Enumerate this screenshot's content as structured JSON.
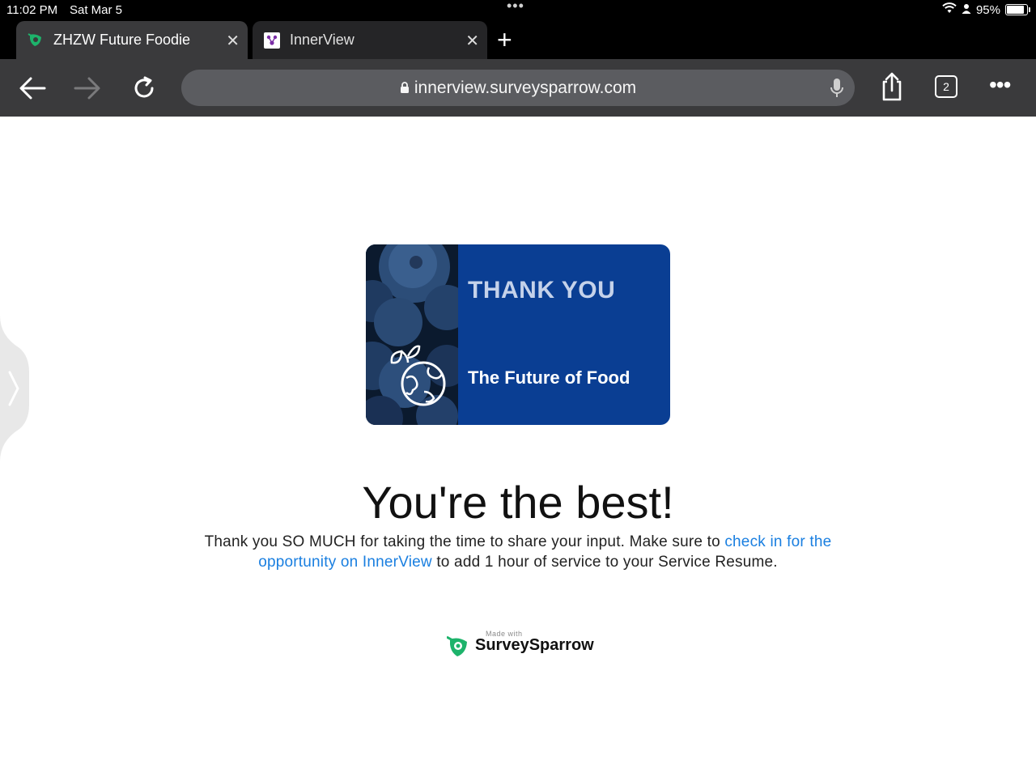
{
  "status_bar": {
    "time": "11:02 PM",
    "date": "Sat Mar 5",
    "battery": "95%"
  },
  "tabs": [
    {
      "title": "ZHZW Future Foodie",
      "active": true
    },
    {
      "title": "InnerView",
      "active": false
    }
  ],
  "toolbar": {
    "url": "innerview.surveysparrow.com",
    "tab_count": "2"
  },
  "card": {
    "heading": "THANK YOU",
    "subheading": "The Future of Food"
  },
  "page": {
    "headline": "You're the best!",
    "message_before": "Thank you SO MUCH for taking the time to share your input. Make sure to ",
    "message_link": "check in for the opportunity on InnerView",
    "message_after": " to add 1 hour of service to your Service Resume."
  },
  "footer": {
    "made_with": "Made with",
    "brand": "SurveySparrow"
  },
  "colors": {
    "link": "#1a7fe0",
    "card_bg": "#0a3e93",
    "toolbar_bg": "#3a3a3c",
    "brand_green": "#1db36b"
  },
  "icons": [
    "wifi-icon",
    "person-icon",
    "battery-icon",
    "surveysparrow-favicon",
    "innerview-favicon",
    "close-icon",
    "plus-icon",
    "back-arrow-icon",
    "forward-arrow-icon",
    "reload-icon",
    "lock-icon",
    "mic-icon",
    "share-icon",
    "more-icon",
    "globe-sprout-icon",
    "chevron-right-icon"
  ]
}
